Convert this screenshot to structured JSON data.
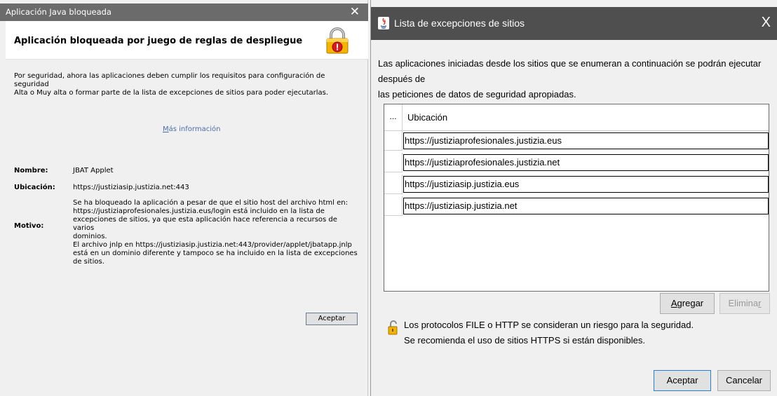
{
  "left_dialog": {
    "title": "Aplicación Java bloqueada",
    "close_glyph": "✕",
    "header": "Aplicación bloqueada por juego de reglas de despliegue",
    "intro_line1": "Por seguridad, ahora las aplicaciones deben cumplir los requisitos para configuración de seguridad",
    "intro_line2": "Alta o Muy alta o formar parte de la lista de excepciones de sitios para poder ejecutarlas.",
    "more_info_access_key": "M",
    "more_info_rest": "ás información",
    "name_label": "Nombre:",
    "name_value": "JBAT Applet",
    "location_label": "Ubicación:",
    "location_value": "https://justiziasip.justizia.net:443",
    "reason_label": "Motivo:",
    "reason_lines": [
      "Se ha bloqueado la aplicación a pesar de que el sitio host del archivo html en:",
      "https://justiziaprofesionales.justizia.eus/login está incluido en la lista de",
      "excepciones de sitios, ya que esta aplicación hace referencia a recursos de varios",
      "dominios.",
      "El archivo jnlp en https://justiziasip.justizia.net:443/provider/applet/jbatapp.jnlp",
      "está en un dominio diferente y tampoco se ha incluido en la lista de excepciones",
      "de sitios."
    ],
    "ok_button": "Aceptar",
    "icon": "padlock-warning-icon"
  },
  "right_dialog": {
    "title": "Lista de excepciones de sitios",
    "close_glyph": "X",
    "icon": "java-icon",
    "description_line1": "Las aplicaciones iniciadas desde los sitios que se enumeran a continuación se podrán ejecutar después de",
    "description_line2": "las peticiones de datos de seguridad apropiadas.",
    "table": {
      "header_marker": "...",
      "column": "Ubicación",
      "rows": [
        "https://justiziaprofesionales.justizia.eus",
        "https://justiziaprofesionales.justizia.net",
        "https://justiziasip.justizia.eus",
        "https://justiziasip.justizia.net"
      ]
    },
    "add_button_key": "A",
    "add_button_rest": "gregar",
    "remove_button_main": "Elimina",
    "remove_button_key": "r",
    "warning_line1": "Los protocolos FILE o HTTP se consideran un riesgo para la seguridad.",
    "warning_line2": "Se recomienda el uso de sitios HTTPS si están disponibles.",
    "ok_button": "Aceptar",
    "cancel_button": "Cancelar",
    "warning_icon": "unlocked-padlock-icon"
  }
}
